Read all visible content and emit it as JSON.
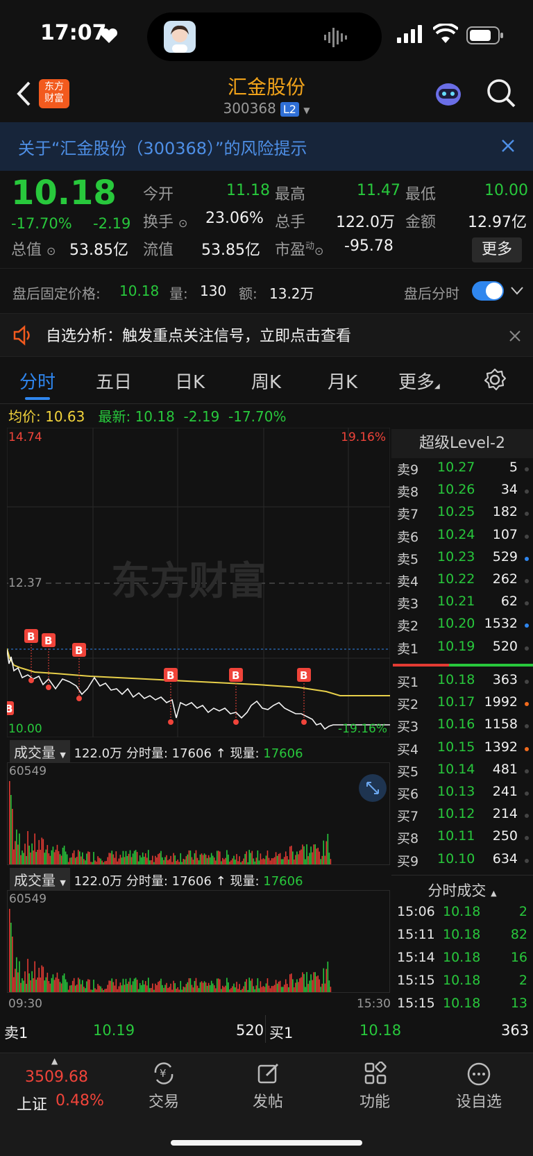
{
  "status_bar": {
    "time": "17:07"
  },
  "nav": {
    "title": "汇金股份",
    "code": "300368",
    "badge": "L2",
    "brand": "东方\n财富"
  },
  "risk_banner": {
    "text": "关于“汇金股份（300368）”的风险提示"
  },
  "quote": {
    "price": "10.18",
    "change_pct": "-17.70%",
    "change": "-2.19",
    "open_label": "今开",
    "open": "11.18",
    "high_label": "最高",
    "high": "11.47",
    "low_label": "最低",
    "low": "10.00",
    "turnover_label": "换手",
    "turnover": "23.06%",
    "total_hands_label": "总手",
    "total_hands": "122.0万",
    "amount_label": "金额",
    "amount": "12.97亿",
    "mcap_label": "总值",
    "mcap": "53.85亿",
    "float_label": "流值",
    "float": "53.85亿",
    "pe_label": "市盈",
    "pe_sup": "动",
    "pe": "-95.78",
    "more_label": "更多"
  },
  "after_hours": {
    "price_label": "盘后固定价格:",
    "price": "10.18",
    "vol_label": "量:",
    "vol": "130",
    "amt_label": "额:",
    "amt": "13.2万",
    "toggle_label": "盘后分时"
  },
  "analysis": {
    "text": "自选分析：触发重点关注信号，立即点击查看"
  },
  "tabs": [
    {
      "label": "分时"
    },
    {
      "label": "五日"
    },
    {
      "label": "日K"
    },
    {
      "label": "周K"
    },
    {
      "label": "月K"
    },
    {
      "label": "更多"
    }
  ],
  "avg_info": {
    "avg_label": "均价:",
    "avg": "10.63",
    "latest_label": "最新:",
    "latest": "10.18",
    "chg": "-2.19",
    "pct": "-17.70%"
  },
  "chart": {
    "top_price": "14.74",
    "top_pct": "19.16%",
    "mid_price": "12.37",
    "bottom_price": "10.00",
    "bottom_pct": "-19.16%",
    "watermark": "东方财富",
    "marker": "B"
  },
  "volume_panel": {
    "label": "成交量",
    "total": "122.0万",
    "tick_label": "分时量:",
    "tick": "17606",
    "cur_label": "现量:",
    "cur": "17606",
    "max": "60549",
    "start_time": "09:30",
    "end_time": "15:30"
  },
  "level2": {
    "title": "超级Level-2",
    "asks": [
      {
        "label": "卖9",
        "price": "10.27",
        "vol": "5"
      },
      {
        "label": "卖8",
        "price": "10.26",
        "vol": "34"
      },
      {
        "label": "卖7",
        "price": "10.25",
        "vol": "182"
      },
      {
        "label": "卖6",
        "price": "10.24",
        "vol": "107"
      },
      {
        "label": "卖5",
        "price": "10.23",
        "vol": "529"
      },
      {
        "label": "卖4",
        "price": "10.22",
        "vol": "262"
      },
      {
        "label": "卖3",
        "price": "10.21",
        "vol": "62"
      },
      {
        "label": "卖2",
        "price": "10.20",
        "vol": "1532"
      },
      {
        "label": "卖1",
        "price": "10.19",
        "vol": "520"
      }
    ],
    "bids": [
      {
        "label": "买1",
        "price": "10.18",
        "vol": "363"
      },
      {
        "label": "买2",
        "price": "10.17",
        "vol": "1992"
      },
      {
        "label": "买3",
        "price": "10.16",
        "vol": "1158"
      },
      {
        "label": "买4",
        "price": "10.15",
        "vol": "1392"
      },
      {
        "label": "买5",
        "price": "10.14",
        "vol": "481"
      },
      {
        "label": "买6",
        "price": "10.13",
        "vol": "241"
      },
      {
        "label": "买7",
        "price": "10.12",
        "vol": "214"
      },
      {
        "label": "买8",
        "price": "10.11",
        "vol": "250"
      },
      {
        "label": "买9",
        "price": "10.10",
        "vol": "634"
      }
    ],
    "trades_title": "分时成交",
    "trades": [
      {
        "time": "15:06",
        "price": "10.18",
        "vol": "2"
      },
      {
        "time": "15:11",
        "price": "10.18",
        "vol": "82"
      },
      {
        "time": "15:14",
        "price": "10.18",
        "vol": "16"
      },
      {
        "time": "15:15",
        "price": "10.18",
        "vol": "2"
      },
      {
        "time": "15:15",
        "price": "10.18",
        "vol": "13"
      }
    ]
  },
  "bottom_quote": {
    "ask_label": "卖1",
    "ask_price": "10.19",
    "ask_vol": "520",
    "bid_label": "买1",
    "bid_price": "10.18",
    "bid_vol": "363"
  },
  "tabbar": {
    "index_value": "3509.68",
    "index_name": "上证",
    "index_pct": "0.48%",
    "items": [
      {
        "label": "交易"
      },
      {
        "label": "发帖"
      },
      {
        "label": "功能"
      },
      {
        "label": "设自选"
      }
    ]
  }
}
